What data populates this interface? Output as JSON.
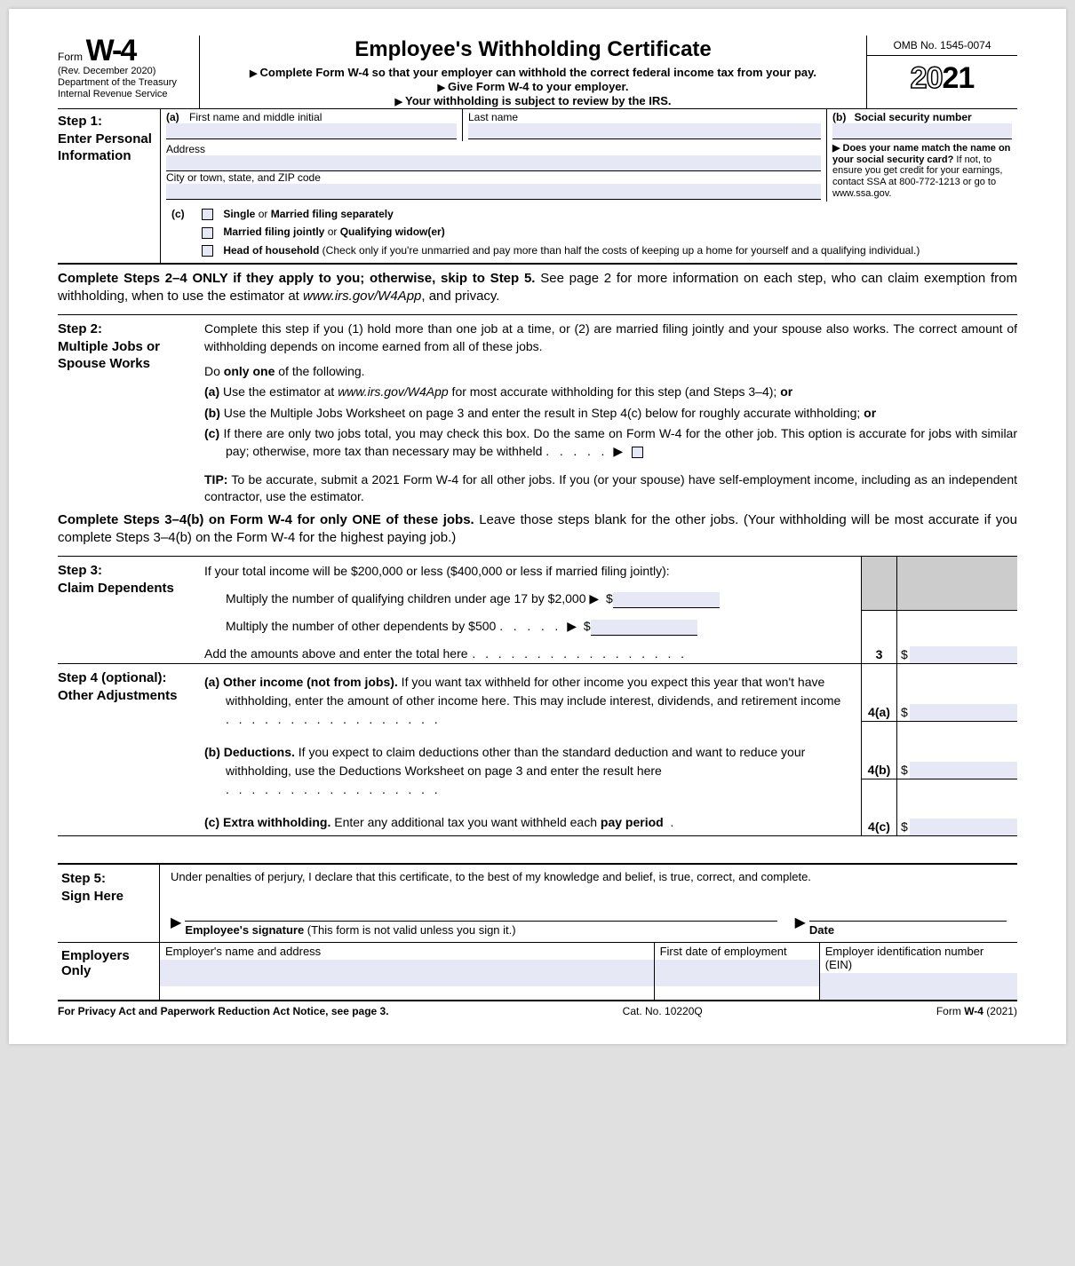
{
  "header": {
    "form_word": "Form",
    "form_num": "W-4",
    "rev": "(Rev. December 2020)",
    "dept": "Department of the Treasury",
    "irs": "Internal Revenue Service",
    "title": "Employee's Withholding Certificate",
    "line1": "Complete Form W-4 so that your employer can withhold the correct federal income tax from your pay.",
    "line2": "Give Form W-4 to your employer.",
    "line3": "Your withholding is subject to review by the IRS.",
    "omb": "OMB No. 1545-0074",
    "year_outline": "20",
    "year_solid": "21"
  },
  "step1": {
    "label": "Step 1:",
    "sub": "Enter Personal Information",
    "a_label": "(a)",
    "first": "First name and middle initial",
    "last": "Last name",
    "b_label": "(b)",
    "ssn": "Social security number",
    "address": "Address",
    "city": "City or town, state, and ZIP code",
    "note_lead": "▶ Does your name match the name on your social security card?",
    "note_rest": " If not, to ensure you get credit for your earnings, contact SSA at 800-772-1213 or go to www.ssa.gov.",
    "c_label": "(c)",
    "opt1a": "Single",
    "opt1b": " or ",
    "opt1c": "Married filing separately",
    "opt2a": "Married filing jointly",
    "opt2b": " or ",
    "opt2c": "Qualifying widow(er)",
    "opt3a": "Head of household",
    "opt3b": " (Check only if you're unmarried and pay more than half the costs of keeping up a home for yourself and a qualifying individual.)"
  },
  "inter1": {
    "bold": "Complete Steps 2–4 ONLY if they apply to you; otherwise, skip to Step 5.",
    "rest": " See page 2 for more information on each step, who can claim exemption from withholding, when to use the estimator at ",
    "site": "www.irs.gov/W4App",
    "rest2": ", and privacy."
  },
  "step2": {
    "label": "Step 2:",
    "sub": "Multiple Jobs or Spouse Works",
    "intro": "Complete this step if you (1) hold more than one job at a time, or (2) are married filing jointly and your spouse also works. The correct amount of withholding depends on income earned from all of these jobs.",
    "do_one_a": "Do ",
    "do_one_b": "only one",
    "do_one_c": " of the following.",
    "a1": "(a)",
    "a2": " Use the estimator at ",
    "a3": "www.irs.gov/W4App",
    "a4": " for most accurate withholding for this step (and Steps 3–4); ",
    "a5": "or",
    "b1": "(b)",
    "b2": " Use the Multiple Jobs Worksheet on page 3 and enter the result in Step 4(c) below for roughly accurate withholding; ",
    "b3": "or",
    "c1": "(c)",
    "c2": " If there are only two jobs total, you may check this box. Do the same on Form W-4 for the other job. This option is accurate for jobs with similar pay; otherwise, more tax than necessary may be withheld",
    "c3": "▶",
    "tip_a": "TIP:",
    "tip_b": " To be accurate, submit a 2021 Form W-4 for all other jobs. If you (or your spouse) have self-employment income, including as an independent contractor, use the estimator."
  },
  "inter2": {
    "bold": "Complete Steps 3–4(b) on Form W-4 for only ONE of these jobs.",
    "rest": " Leave those steps blank for the other jobs. (Your withholding will be most accurate if you complete Steps 3–4(b) on the Form W-4 for the highest paying job.)"
  },
  "step3": {
    "label": "Step 3:",
    "sub": "Claim Dependents",
    "intro": "If your total income will be $200,000 or less ($400,000 or less if married filing jointly):",
    "l1": "Multiply the number of qualifying children under age 17 by $2,000 ▶",
    "l1d": "$",
    "l2": "Multiply the number of other dependents by $500",
    "l2arrow": "▶",
    "l2d": "$",
    "total": "Add the amounts above and enter the total here",
    "num": "3",
    "dollar": "$"
  },
  "step4": {
    "label": "Step 4 (optional):",
    "sub": "Other Adjustments",
    "a_l": "(a)",
    "a_h": "Other income (not from jobs).",
    "a_t": " If you want tax withheld for other income you expect this year that won't have withholding, enter the amount of other income here. This may include interest, dividends, and retirement income",
    "a_n": "4(a)",
    "b_l": "(b)",
    "b_h": "Deductions.",
    "b_t": " If you expect to claim deductions other than the standard deduction and want to reduce your withholding, use the Deductions Worksheet on page 3 and enter the result here",
    "b_n": "4(b)",
    "c_l": "(c)",
    "c_h": "Extra withholding.",
    "c_t": " Enter any additional tax you want withheld each ",
    "c_t2": "pay period",
    "c_n": "4(c)",
    "dollar": "$"
  },
  "step5": {
    "label": "Step 5:",
    "sub": "Sign Here",
    "declare": "Under penalties of perjury, I declare that this certificate, to the best of my knowledge and belief, is true, correct, and complete.",
    "sig_a": "Employee's signature",
    "sig_b": " (This form is not valid unless you sign it.)",
    "date": "Date"
  },
  "emp": {
    "label": "Employers Only",
    "name": "Employer's name and address",
    "first_date": "First date of employment",
    "ein": "Employer identification number (EIN)"
  },
  "footer": {
    "left": "For Privacy Act and Paperwork Reduction Act Notice, see page 3.",
    "mid": "Cat. No. 10220Q",
    "right_a": "Form ",
    "right_b": "W-4",
    "right_c": " (2021)"
  },
  "chart_data": null
}
